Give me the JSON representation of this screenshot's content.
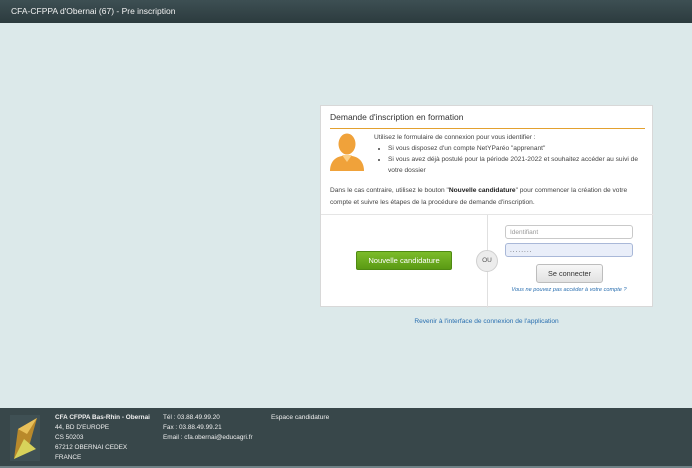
{
  "header": {
    "title": "CFA-CFPPA d'Obernai (67) - Pre inscription"
  },
  "card": {
    "title": "Demande d'inscription en formation",
    "intro": "Utilisez le formulaire de connexion pour vous identifier :",
    "bullets": [
      "Si vous disposez d'un compte NetYParéo \"apprenant\"",
      "Si vous avez déjà postulé pour la période 2021-2022 et souhaitez accéder au suivi de votre dossier"
    ],
    "help_pre": "Dans le cas contraire, utilisez le bouton \"",
    "help_button_name": "Nouvelle candidature",
    "help_post": "\" pour commencer la création de votre compte et suivre les étapes de la procédure de demande d'inscription."
  },
  "actions": {
    "new_candidature": "Nouvelle candidature",
    "or": "OU",
    "login_placeholder": "Identifiant",
    "password_value": "........",
    "connect": "Se connecter",
    "forgot": "Vous ne pouvez pas accéder à votre compte ?"
  },
  "back_link": "Revenir à l'interface de connexion de l'application",
  "footer": {
    "address": [
      "CFA CFPPA Bas-Rhin - Obernai",
      "44, BD D'EUROPE",
      "CS 50203",
      "67212 OBERNAI CEDEX",
      "FRANCE"
    ],
    "contact": [
      "Tél : 03.88.49.99.20",
      "Fax : 03.88.49.99.21",
      "Email : cfa.obernai@educagri.fr"
    ],
    "space": "Espace candidature"
  },
  "icons": {
    "user": "person-silhouette-icon",
    "logo": "cfa-logo-icon"
  },
  "colors": {
    "accent": "#e3a12f",
    "primary_button": "#6aab1e",
    "link": "#2a6fb0",
    "header_bg": "#34464a"
  }
}
